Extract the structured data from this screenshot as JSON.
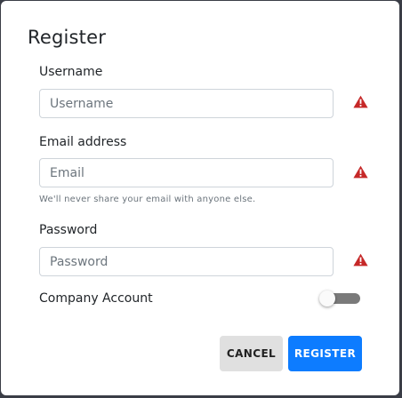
{
  "dialog": {
    "title": "Register"
  },
  "form": {
    "username": {
      "label": "Username",
      "placeholder": "Username",
      "value": ""
    },
    "email": {
      "label": "Email address",
      "placeholder": "Email",
      "value": "",
      "help": "We'll never share your email with anyone else."
    },
    "password": {
      "label": "Password",
      "placeholder": "Password",
      "value": ""
    },
    "company_account": {
      "label": "Company Account",
      "checked": false
    }
  },
  "actions": {
    "cancel_label": "CANCEL",
    "register_label": "REGISTER"
  },
  "icons": {
    "warning": "warning-icon"
  },
  "colors": {
    "warning": "#c62828",
    "primary": "#0d7cff",
    "cancel_bg": "#e0e0e0",
    "toggle_off": "#7a7a7a"
  }
}
